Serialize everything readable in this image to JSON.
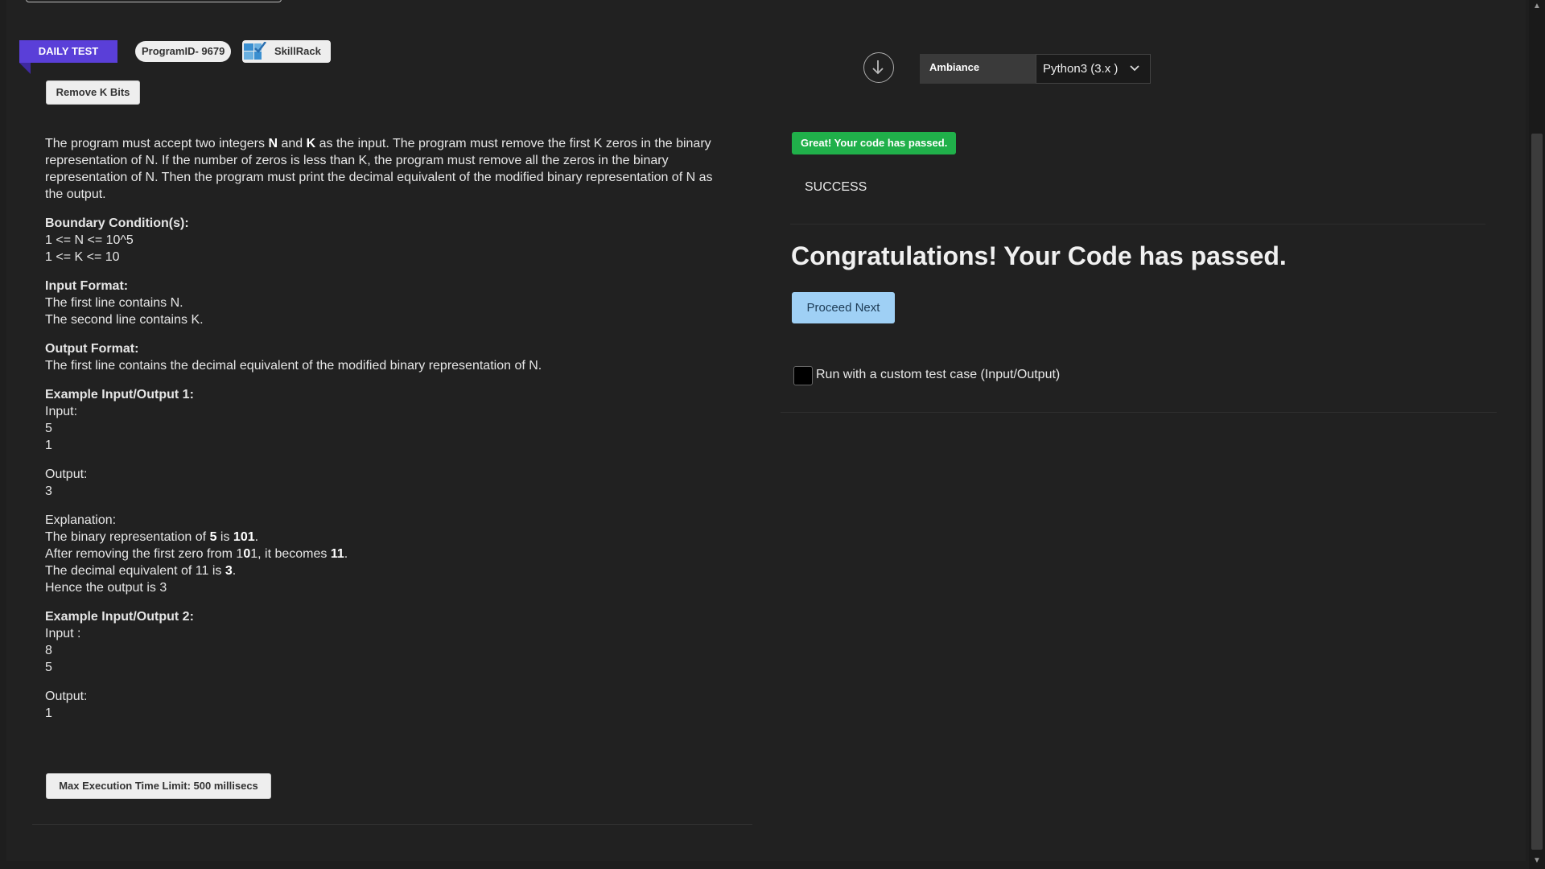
{
  "header": {
    "daily_tag": "DAILY TEST",
    "program_id": "ProgramID- 9679",
    "brand": "SkillRack",
    "problem_title": "Remove K Bits"
  },
  "problem": {
    "intro_1": "The program must accept two integers ",
    "intro_n": "N",
    "intro_and": " and ",
    "intro_k": "K",
    "intro_2": " as the input. The program must remove the first K zeros in the binary representation of N. If the number of zeros is less than K, the program must remove all the zeros in the binary representation of N. Then the program must print the decimal equivalent of the modified binary representation of N as the output.",
    "boundary_heading": "Boundary Condition(s):",
    "boundary_1": "1 <= N <= 10^5",
    "boundary_2": "1 <= K <= 10",
    "input_heading": "Input Format:",
    "input_1": "The first line contains N.",
    "input_2": "The second line contains K.",
    "output_heading": "Output Format:",
    "output_1": "The first line contains the decimal equivalent of the modified binary representation of N.",
    "ex1_heading": "Example Input/Output 1:",
    "ex1_input_label": "Input:",
    "ex1_in_1": "5",
    "ex1_in_2": "1",
    "ex1_output_label": "Output:",
    "ex1_out": "3",
    "expl_label": "Explanation:",
    "expl_1a": "The binary representation of ",
    "expl_1b": "5",
    "expl_1c": " is ",
    "expl_1d": "101",
    "expl_1e": ".",
    "expl_2a": "After removing the first zero from 1",
    "expl_2b": "0",
    "expl_2c": "1, it becomes ",
    "expl_2d": "11",
    "expl_2e": ".",
    "expl_3a": "The decimal equivalent of 11 is ",
    "expl_3b": "3",
    "expl_3c": ".",
    "expl_4": "Hence the output is 3",
    "ex2_heading": "Example Input/Output 2:",
    "ex2_input_label": "Input :",
    "ex2_in_1": "8",
    "ex2_in_2": "5",
    "ex2_output_label": "Output:",
    "ex2_out": "1",
    "time_limit": "Max Execution Time Limit: 500 millisecs"
  },
  "editor_bar": {
    "theme": "Ambiance",
    "language": "Python3 (3.x )"
  },
  "result": {
    "badge": "Great! Your code has passed.",
    "status": "SUCCESS",
    "congrats": "Congratulations! Your Code has passed.",
    "proceed": "Proceed Next",
    "custom_label": "Run with a custom test case (Input/Output)"
  },
  "colors": {
    "accent": "#5a3fd8",
    "success": "#20b04a",
    "proceed_button": "#9fd0f5",
    "background": "#212121"
  }
}
